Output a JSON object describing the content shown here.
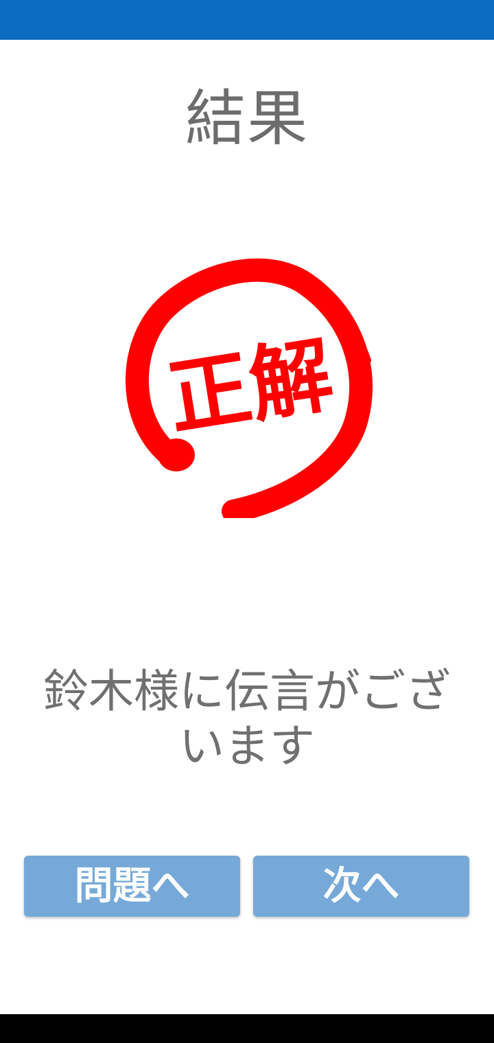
{
  "status_bar": {
    "color": "#0c6cbf"
  },
  "header": {
    "title": "結果"
  },
  "result_stamp": {
    "text": "正解",
    "color": "#ff0000",
    "icon": "red-brush-circle-icon"
  },
  "message": {
    "text": "鈴木様に伝言がございます"
  },
  "buttons": {
    "to_question_label": "問題へ",
    "next_label": "次へ",
    "color": "#76a9d8"
  },
  "nav_bar": {
    "color": "#000000"
  }
}
